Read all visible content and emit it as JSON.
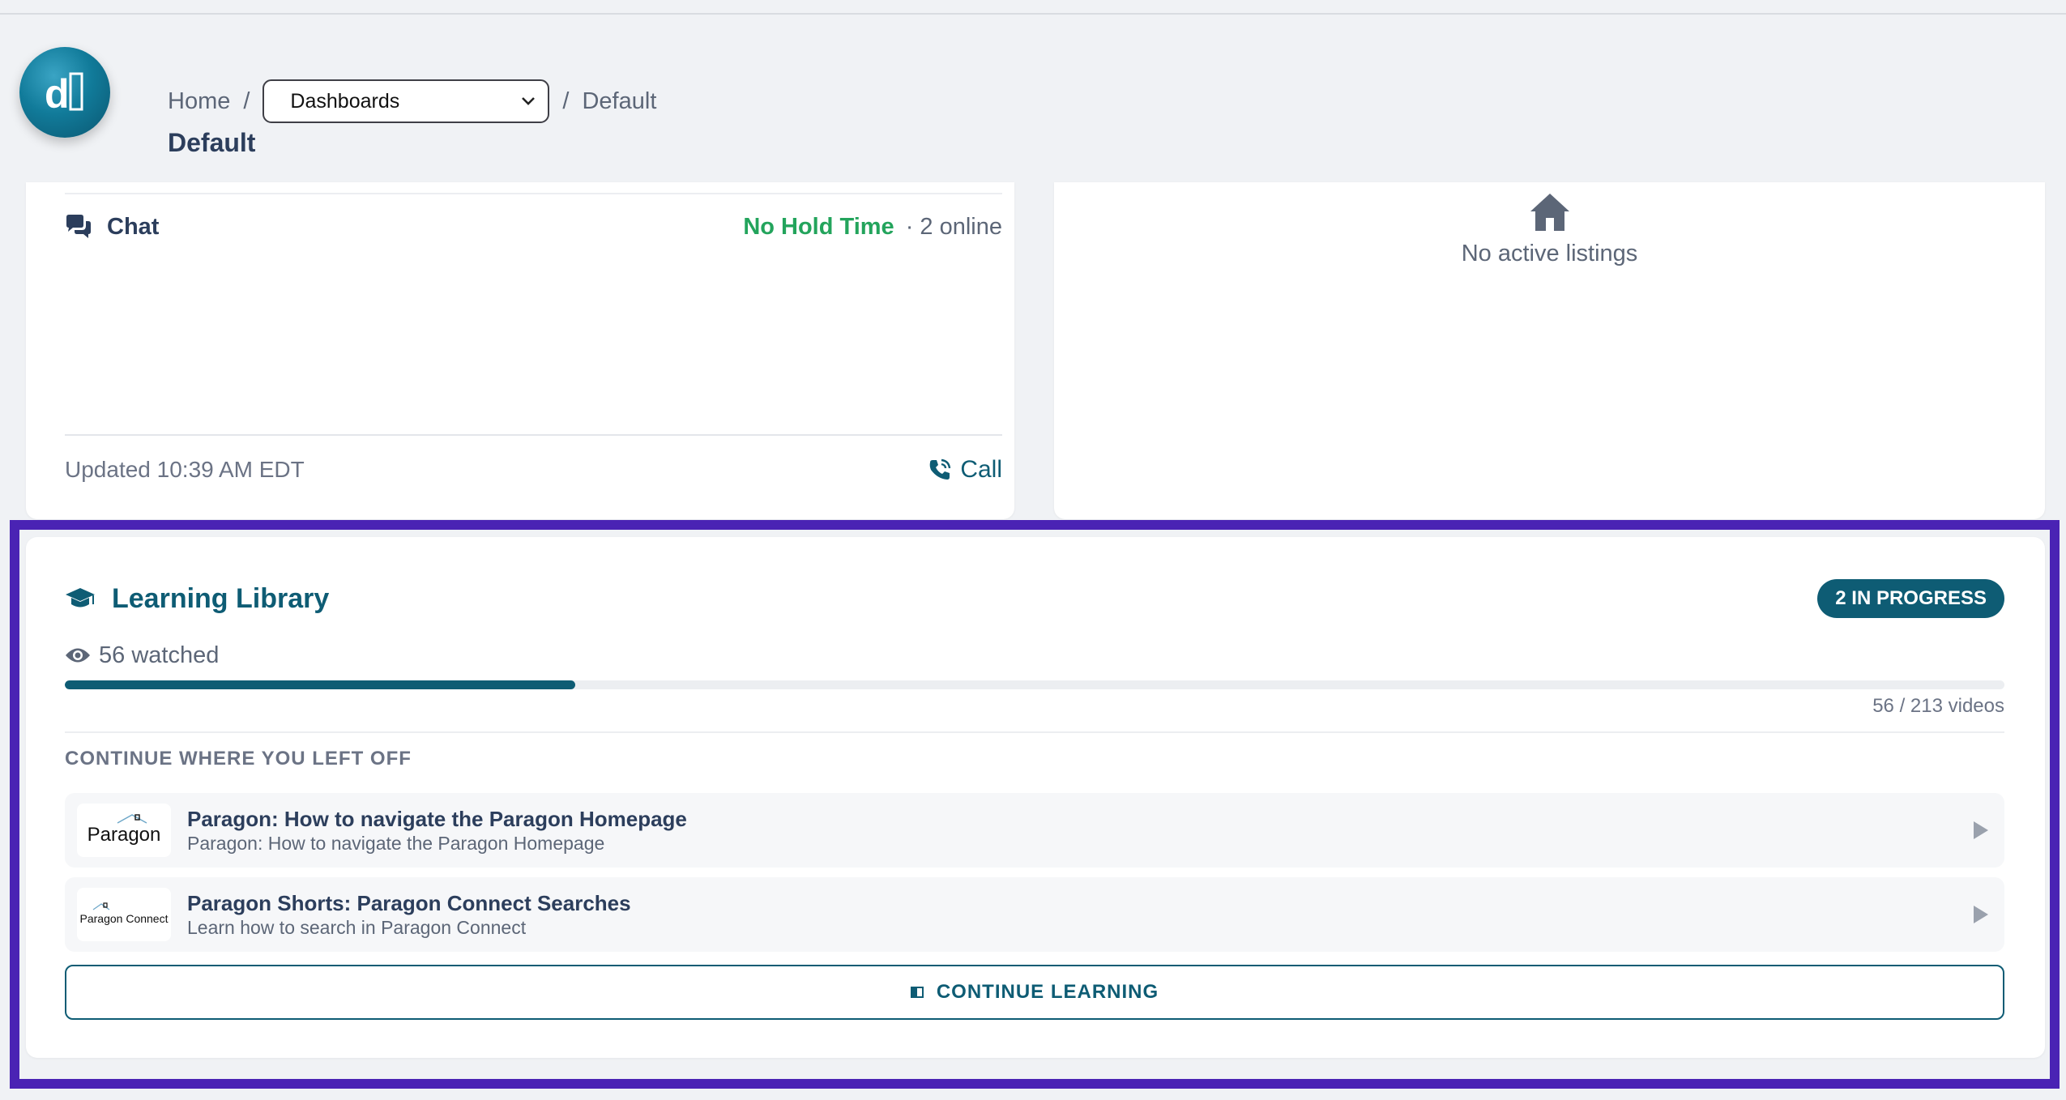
{
  "breadcrumb": {
    "home": "Home",
    "separator": "/",
    "dashboard_select": "Dashboards",
    "current": "Default"
  },
  "page_title": "Default",
  "chat_card": {
    "title": "Chat",
    "hold_status": "No Hold Time",
    "online": "· 2 online",
    "updated": "Updated 10:39 AM EDT",
    "call_label": "Call"
  },
  "listings_card": {
    "empty_text": "No active listings"
  },
  "learning_library": {
    "title": "Learning Library",
    "badge": "2 IN PROGRESS",
    "watched": "56 watched",
    "progress_fraction": 0.263,
    "video_count": "56 / 213 videos",
    "continue_label": "CONTINUE WHERE YOU LEFT OFF",
    "videos": [
      {
        "thumb_text": "Paragon",
        "title": "Paragon: How to navigate the Paragon Homepage",
        "subtitle": "Paragon: How to navigate the Paragon Homepage"
      },
      {
        "thumb_text": "Paragon Connect",
        "title": "Paragon Shorts: Paragon Connect Searches",
        "subtitle": "Learn how to search in Paragon Connect"
      }
    ],
    "continue_button": "CONTINUE LEARNING"
  },
  "colors": {
    "accent": "#0e5c74",
    "success": "#23a45c",
    "highlight_frame": "#4a23b4"
  },
  "icons": {
    "logo": "d-logo",
    "chat": "chat-bubbles-icon",
    "call": "phone-icon",
    "listings": "house-icon",
    "learning": "graduation-cap-icon",
    "watched": "eye-icon",
    "play": "play-icon",
    "dropdown": "chevron-down-icon"
  }
}
